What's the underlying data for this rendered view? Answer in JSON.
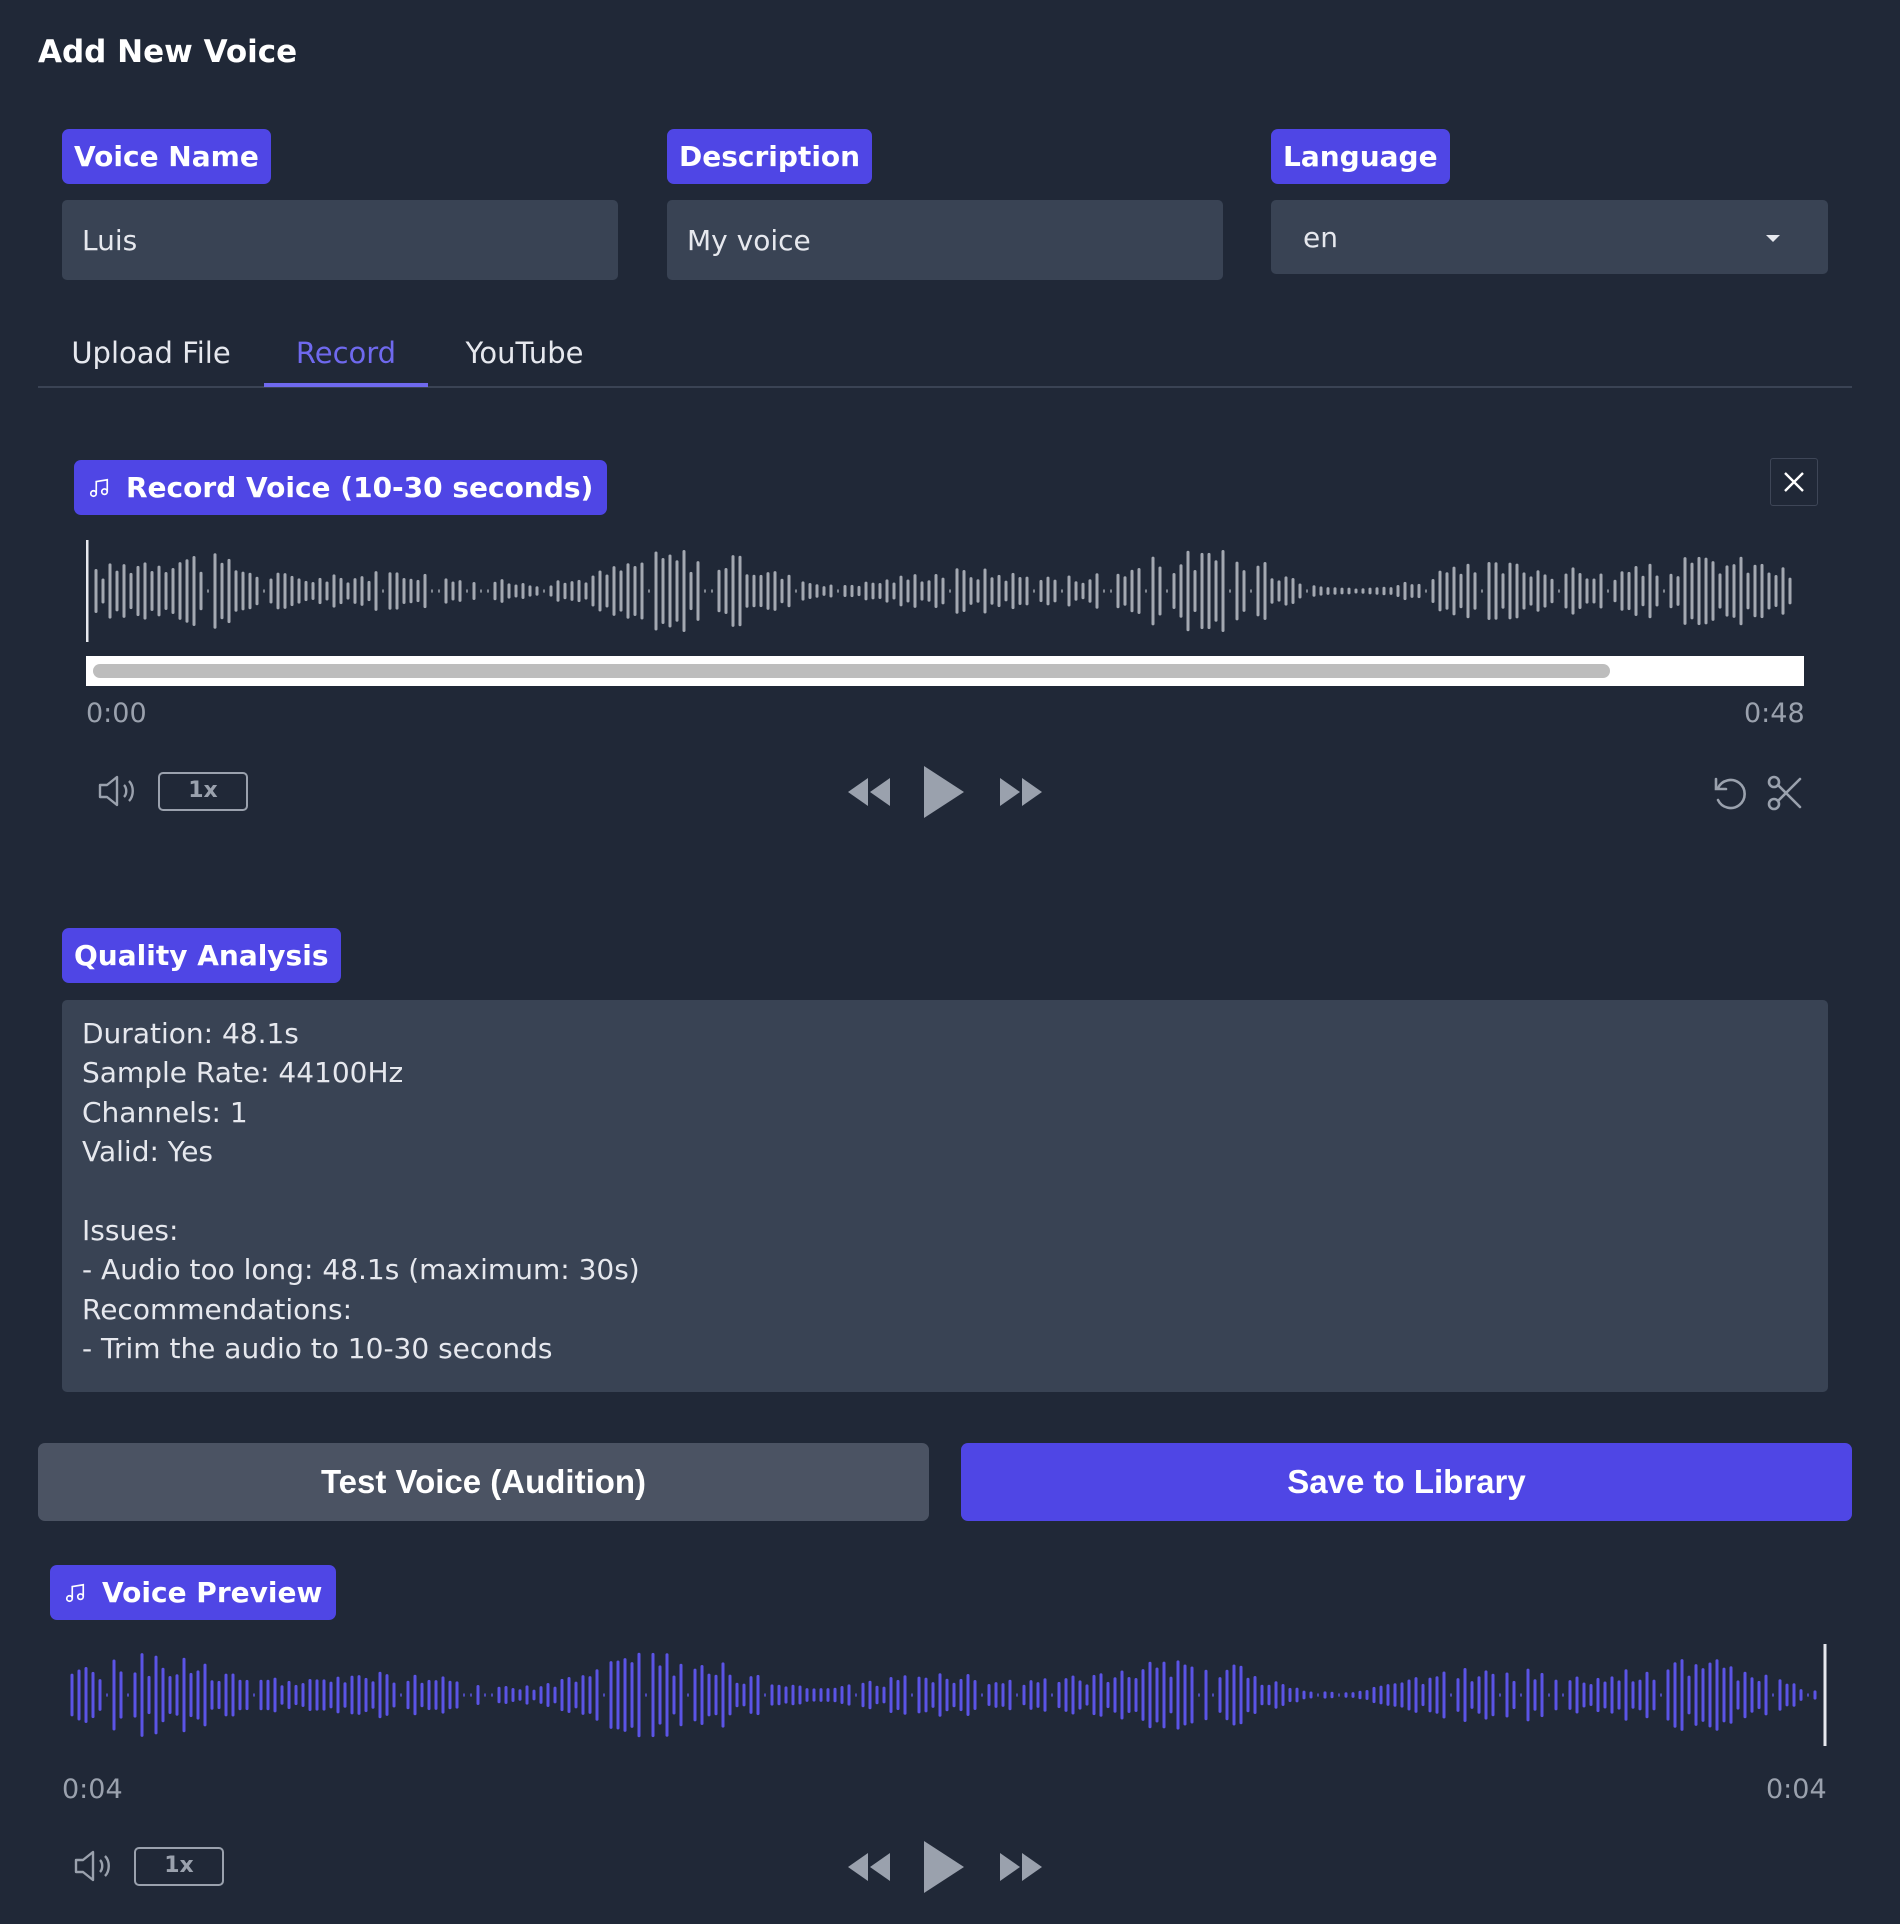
{
  "page": {
    "title": "Add New Voice"
  },
  "form": {
    "voice_name": {
      "label": "Voice Name",
      "value": "Luis"
    },
    "description": {
      "label": "Description",
      "value": "My voice"
    },
    "language": {
      "label": "Language",
      "value": "en"
    }
  },
  "tabs": [
    {
      "label": "Upload File",
      "active": false
    },
    {
      "label": "Record",
      "active": true
    },
    {
      "label": "YouTube",
      "active": false
    }
  ],
  "record_player": {
    "label": "Record Voice (10-30 seconds)",
    "time_start": "0:00",
    "time_end": "0:48",
    "speed": "1x",
    "progress": 0.89
  },
  "quality": {
    "label": "Quality Analysis",
    "lines": [
      "Duration: 48.1s",
      "Sample Rate: 44100Hz",
      "Channels: 1",
      "Valid: Yes",
      "",
      "Issues:",
      "- Audio too long: 48.1s (maximum: 30s)",
      "Recommendations:",
      "- Trim the audio to 10-30 seconds"
    ]
  },
  "buttons": {
    "test_label": "Test Voice (Audition)",
    "save_label": "Save to Library"
  },
  "preview_player": {
    "label": "Voice Preview",
    "time_start": "0:04",
    "time_end": "0:04",
    "speed": "1x"
  },
  "colors": {
    "background": "#202837",
    "field": "#394354",
    "accent": "#4f46e5",
    "active_tab": "#6f69ee",
    "wave_gray": "#a3a8b1",
    "wave_purple": "#5b54e6"
  },
  "icons": {
    "music": "music-note-icon",
    "close": "close-icon",
    "volume": "volume-icon",
    "rewind": "rewind-icon",
    "play": "play-icon",
    "forward": "fast-forward-icon",
    "reset": "reset-icon",
    "trim": "scissors-icon",
    "dropdown": "chevron-down-icon"
  }
}
